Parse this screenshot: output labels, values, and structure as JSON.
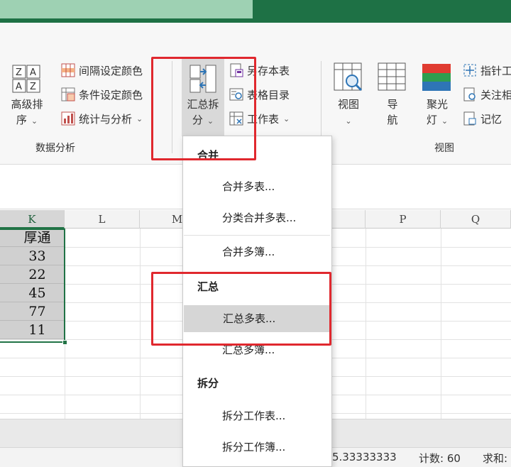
{
  "ribbon": {
    "sort_button": {
      "label_line1": "高级排",
      "label_line2": "序"
    },
    "small_left": [
      {
        "label": "间隔设定颜色"
      },
      {
        "label": "条件设定颜色"
      },
      {
        "label": "统计与分析"
      }
    ],
    "group_data_analysis": "数据分析",
    "merge_split_button": {
      "label_line1": "汇总拆",
      "label_line2": "分"
    },
    "small_mid": [
      {
        "label": "另存本表"
      },
      {
        "label": "表格目录"
      },
      {
        "label": "工作表"
      }
    ],
    "view_buttons": [
      {
        "label_line1": "视图",
        "label_line2": ""
      },
      {
        "label_line1": "导",
        "label_line2": "航"
      },
      {
        "label_line1": "聚光",
        "label_line2": "灯"
      }
    ],
    "small_right": [
      {
        "label": "指针工"
      },
      {
        "label": "关注相"
      },
      {
        "label": "记忆"
      }
    ],
    "group_view": "视图"
  },
  "sheet": {
    "columns": [
      "K",
      "L",
      "M",
      "P",
      "Q"
    ],
    "k_values": [
      "厚通",
      "33",
      "22",
      "45",
      "77",
      "11"
    ]
  },
  "dropdown": {
    "sections": [
      {
        "heading": "合并",
        "items": [
          "合并多表...",
          "分类合并多表...",
          "合并多簿..."
        ]
      },
      {
        "heading": "汇总",
        "items": [
          "汇总多表...",
          "汇总多簿..."
        ]
      },
      {
        "heading": "拆分",
        "items": [
          "拆分工作表...",
          "拆分工作簿..."
        ]
      }
    ],
    "highlighted": "汇总多表..."
  },
  "status": {
    "average": "5.33333333",
    "count": "计数: 60",
    "sum": "求和:"
  },
  "colors": {
    "title_green": "#1e7145",
    "highlight_red": "#e0282e",
    "selection_green": "#217346"
  }
}
